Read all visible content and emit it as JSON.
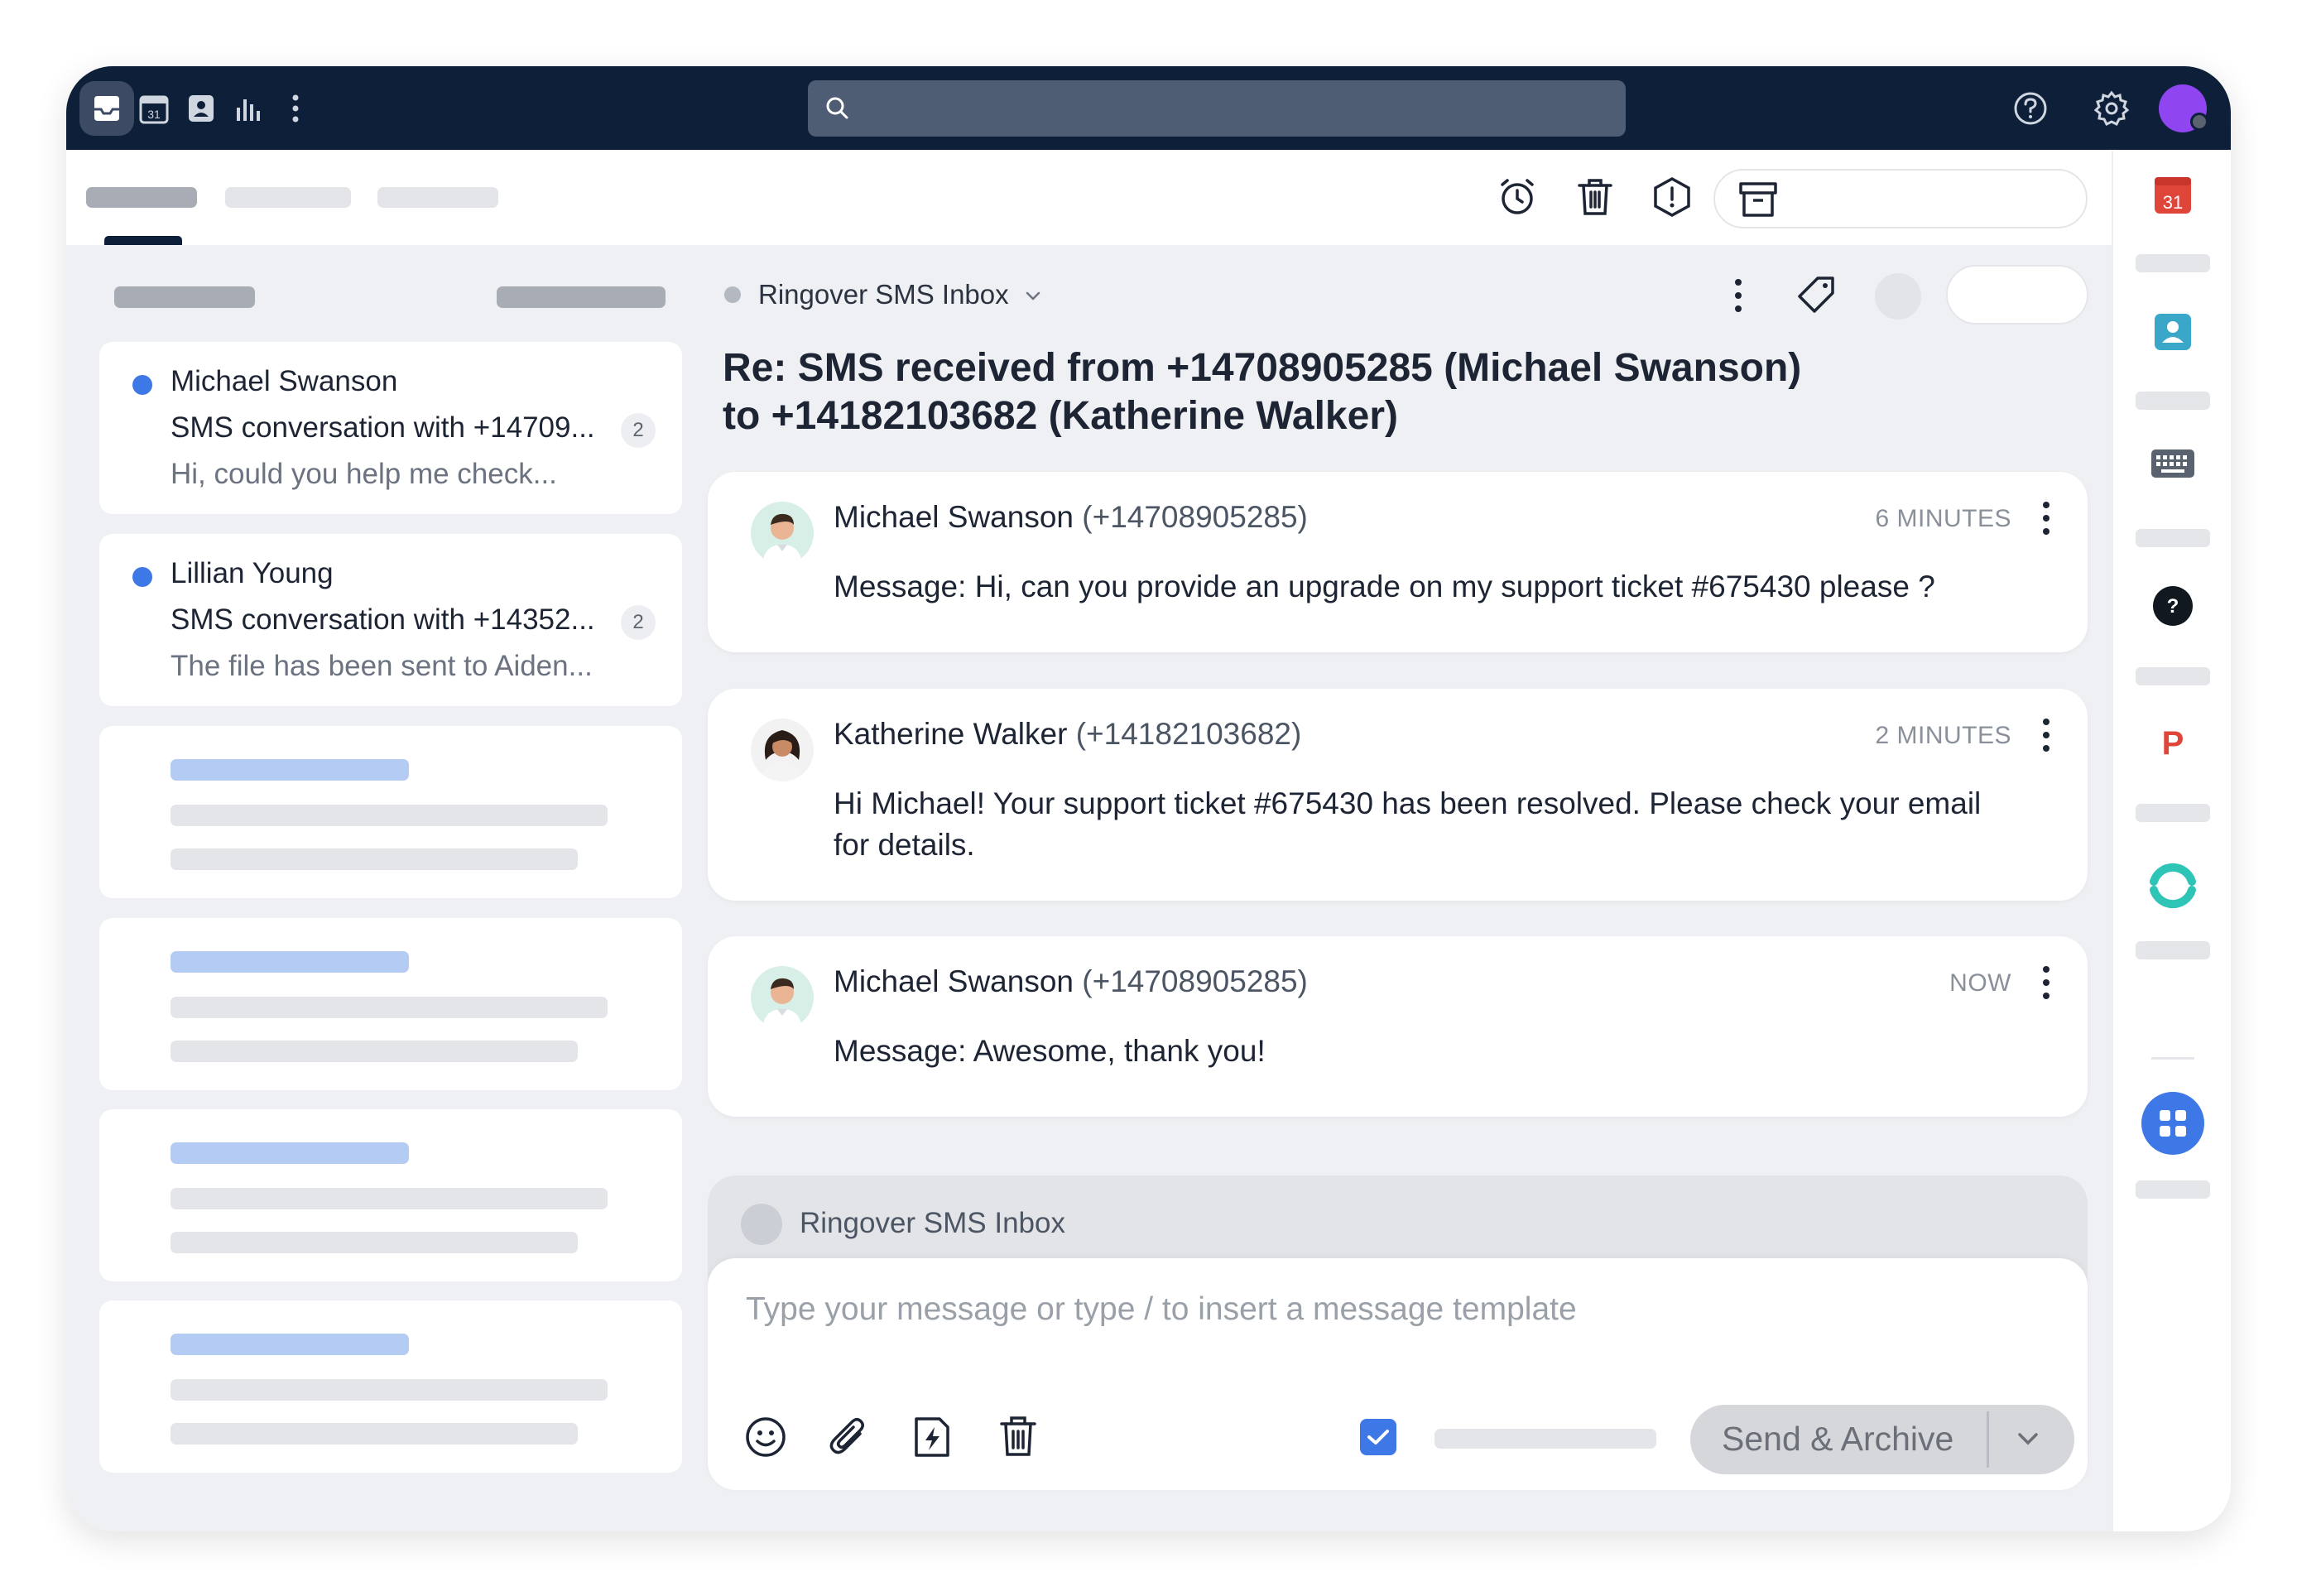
{
  "topbar": {
    "nav_icons": [
      "inbox-icon",
      "calendar-icon",
      "contacts-icon",
      "analytics-icon",
      "more-vertical-icon"
    ],
    "calendar_day": "31",
    "search": {
      "placeholder": ""
    },
    "right_icons": [
      "help-icon",
      "settings-icon",
      "avatar"
    ]
  },
  "toolbar": {
    "actions": [
      "snooze-icon",
      "delete-icon",
      "spam-icon",
      "archive-icon"
    ]
  },
  "conversations": [
    {
      "name": "Michael Swanson",
      "subject": "SMS conversation with +14709...",
      "preview": "Hi, could you help me check...",
      "count": "2",
      "unread": true
    },
    {
      "name": "Lillian Young",
      "subject": "SMS conversation with +14352...",
      "preview": "The file has been sent to Aiden...",
      "count": "2",
      "unread": true
    }
  ],
  "thread": {
    "inbox_label": "Ringover SMS Inbox",
    "title_line1": "Re: SMS received from +14708905285 (Michael Swanson)",
    "title_line2": "to +14182103682 (Katherine Walker)",
    "messages": [
      {
        "sender": "Michael Swanson",
        "phone": "(+14708905285)",
        "time": "6 MINUTES",
        "body": "Message: Hi, can you provide an upgrade on my support ticket #675430 please ?"
      },
      {
        "sender": "Katherine Walker",
        "phone": "(+14182103682)",
        "time": "2 MINUTES",
        "body": "Hi Michael! Your support ticket #675430 has been resolved. Please check your email for details."
      },
      {
        "sender": "Michael Swanson",
        "phone": "(+14708905285)",
        "time": "NOW",
        "body": "Message: Awesome, thank you!"
      }
    ]
  },
  "composer": {
    "from_label": "Ringover SMS Inbox",
    "placeholder": "Type your message or type / to insert a message template",
    "tools": [
      "emoji-icon",
      "attachment-icon",
      "quick-action-icon",
      "discard-icon"
    ],
    "send_label": "Send & Archive",
    "checkbox_checked": true
  },
  "right_rail": {
    "apps": [
      "google-calendar-icon",
      "contacts-app-icon",
      "keyboard-icon",
      "help-app-icon",
      "p-app-icon",
      "ring-app-icon",
      "apps-grid-icon"
    ],
    "calendar_day": "31",
    "p_letter": "P",
    "help_mark": "?"
  },
  "colors": {
    "topbar": "#0e2039",
    "accent": "#3d78e6",
    "avatar": "#8f45ef"
  }
}
